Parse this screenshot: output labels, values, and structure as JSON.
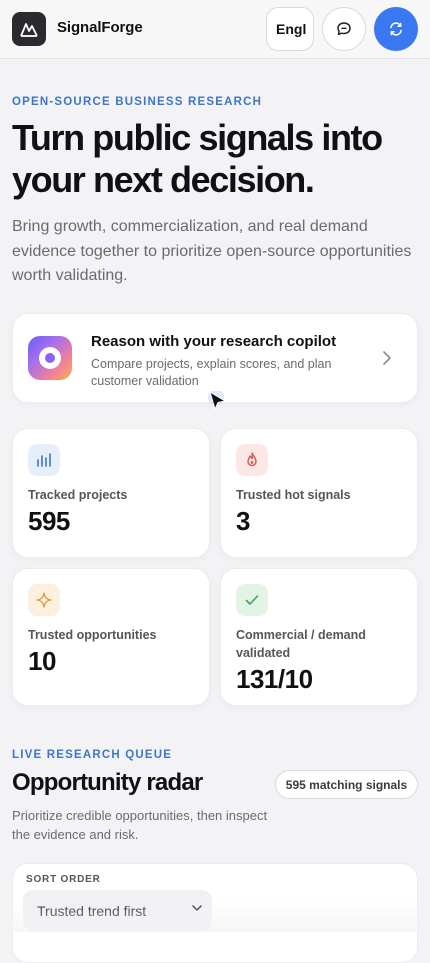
{
  "header": {
    "app_name": "SignalForge",
    "language_label": "Engl",
    "icons": {
      "logo": "mountain-logo-icon",
      "chat": "chat-bubble-icon",
      "sync": "sync-icon"
    }
  },
  "hero": {
    "eyebrow": "OPEN-SOURCE BUSINESS RESEARCH",
    "title": "Turn public signals into your next decision.",
    "subtitle": "Bring growth, commercialization, and real demand evidence together to prioritize open-source opportunities worth validating."
  },
  "copilot": {
    "title": "Reason with your research copilot",
    "description": "Compare projects, explain scores, and plan customer validation",
    "icon": "copilot-orb-icon"
  },
  "stats": [
    {
      "label": "Tracked projects",
      "value": "595",
      "icon": "bar-chart-icon",
      "color": "#3d76c8"
    },
    {
      "label": "Trusted hot signals",
      "value": "3",
      "icon": "flame-icon",
      "color": "#d9534a"
    },
    {
      "label": "Trusted opportunities",
      "value": "10",
      "icon": "sparkle-icon",
      "color": "#e0962e"
    },
    {
      "label": "Commercial / demand validated",
      "value": "131/10",
      "icon": "check-icon",
      "color": "#3da85a"
    }
  ],
  "queue": {
    "eyebrow": "LIVE RESEARCH QUEUE",
    "title": "Opportunity radar",
    "badge": "595 matching signals",
    "subtitle": "Prioritize credible opportunities, then inspect the evidence and risk."
  },
  "sort": {
    "label": "SORT ORDER",
    "selected": "Trusted trend first"
  },
  "colors": {
    "accent": "#3a78f2",
    "eyebrow": "#3d76c8"
  }
}
